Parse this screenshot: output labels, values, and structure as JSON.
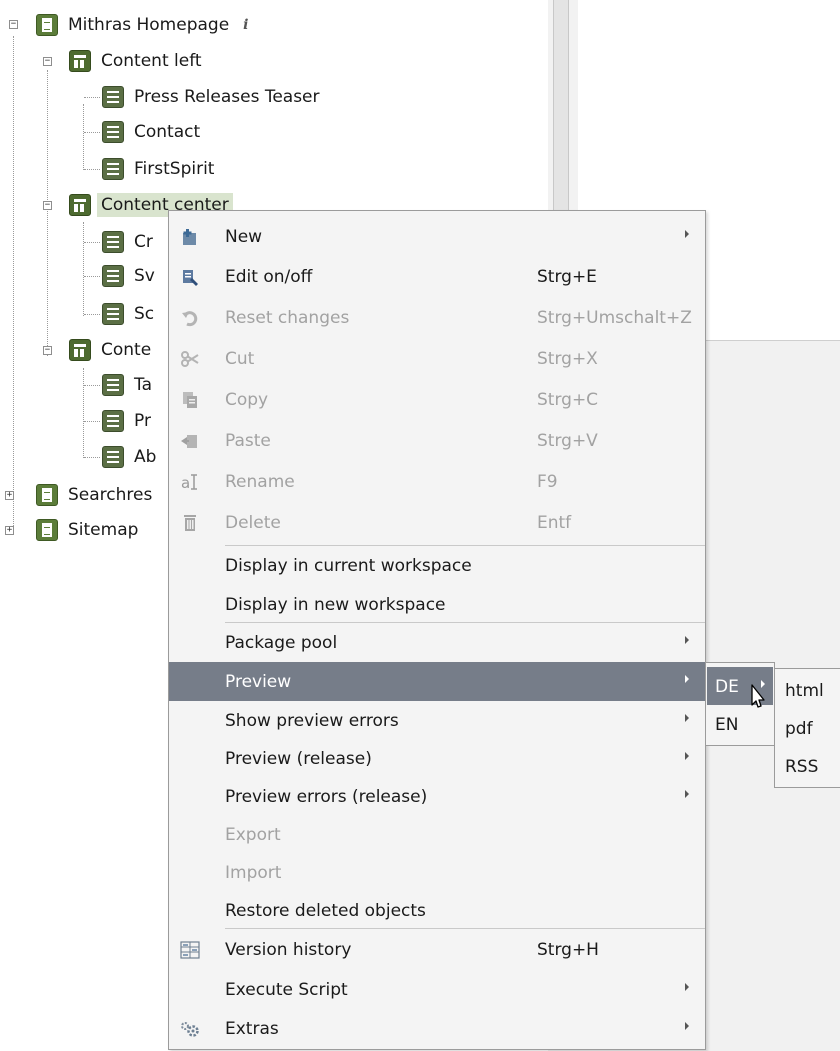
{
  "tree": {
    "root": {
      "label": "Mithras Homepage",
      "info_mark": "i"
    },
    "content_left": {
      "label": "Content left",
      "children": [
        "Press Releases Teaser",
        "Contact",
        "FirstSpirit"
      ]
    },
    "content_center": {
      "label": "Content center",
      "children": [
        "Cr",
        "Sv",
        "Sc"
      ]
    },
    "content_right": {
      "label": "Conte",
      "children": [
        "Ta",
        "Pr",
        "Ab"
      ]
    },
    "searchresults": {
      "label": "Searchres"
    },
    "sitemap": {
      "label": "Sitemap"
    }
  },
  "context_menu": {
    "items": [
      {
        "label": "New",
        "shortcut": "",
        "icon": "new-icon",
        "disabled": false,
        "submenu": true
      },
      {
        "label": "Edit on/off",
        "shortcut": "Strg+E",
        "icon": "edit-icon",
        "disabled": false,
        "submenu": false
      },
      {
        "label": "Reset changes",
        "shortcut": "Strg+Umschalt+Z",
        "icon": "reset-icon",
        "disabled": true,
        "submenu": false
      },
      {
        "label": "Cut",
        "shortcut": "Strg+X",
        "icon": "scissors-icon",
        "disabled": true,
        "submenu": false
      },
      {
        "label": "Copy",
        "shortcut": "Strg+C",
        "icon": "copy-icon",
        "disabled": true,
        "submenu": false
      },
      {
        "label": "Paste",
        "shortcut": "Strg+V",
        "icon": "paste-icon",
        "disabled": true,
        "submenu": false
      },
      {
        "label": "Rename",
        "shortcut": "F9",
        "icon": "rename-icon",
        "disabled": true,
        "submenu": false
      },
      {
        "label": "Delete",
        "shortcut": "Entf",
        "icon": "trash-icon",
        "disabled": true,
        "submenu": false
      },
      {
        "label": "Display in current workspace",
        "shortcut": "",
        "icon": "",
        "disabled": false,
        "submenu": false
      },
      {
        "label": "Display in new workspace",
        "shortcut": "",
        "icon": "",
        "disabled": false,
        "submenu": false
      },
      {
        "label": "Package pool",
        "shortcut": "",
        "icon": "",
        "disabled": false,
        "submenu": true
      },
      {
        "label": "Preview",
        "shortcut": "",
        "icon": "",
        "disabled": false,
        "submenu": true,
        "highlighted": true
      },
      {
        "label": "Show preview errors",
        "shortcut": "",
        "icon": "",
        "disabled": false,
        "submenu": true
      },
      {
        "label": "Preview (release)",
        "shortcut": "",
        "icon": "",
        "disabled": false,
        "submenu": true
      },
      {
        "label": "Preview errors (release)",
        "shortcut": "",
        "icon": "",
        "disabled": false,
        "submenu": true
      },
      {
        "label": "Export",
        "shortcut": "",
        "icon": "",
        "disabled": true,
        "submenu": false
      },
      {
        "label": "Import",
        "shortcut": "",
        "icon": "",
        "disabled": true,
        "submenu": false
      },
      {
        "label": "Restore deleted objects",
        "shortcut": "",
        "icon": "",
        "disabled": false,
        "submenu": false
      },
      {
        "label": "Version history",
        "shortcut": "Strg+H",
        "icon": "version-history-icon",
        "disabled": false,
        "submenu": false
      },
      {
        "label": "Execute Script",
        "shortcut": "",
        "icon": "",
        "disabled": false,
        "submenu": true
      },
      {
        "label": "Extras",
        "shortcut": "",
        "icon": "gears-icon",
        "disabled": false,
        "submenu": true
      }
    ]
  },
  "language_submenu": {
    "items": [
      {
        "label": "DE",
        "highlighted": true,
        "submenu": true
      },
      {
        "label": "EN",
        "highlighted": false,
        "submenu": false
      }
    ]
  },
  "format_submenu": {
    "items": [
      "html",
      "pdf",
      "RSS"
    ]
  },
  "colors": {
    "highlight": "#767d89",
    "menu_bg": "#f4f4f4",
    "disabled_text": "#a2a2a2",
    "selection_bg": "#d9e4ce",
    "icon_green": "#5c7d3a"
  }
}
